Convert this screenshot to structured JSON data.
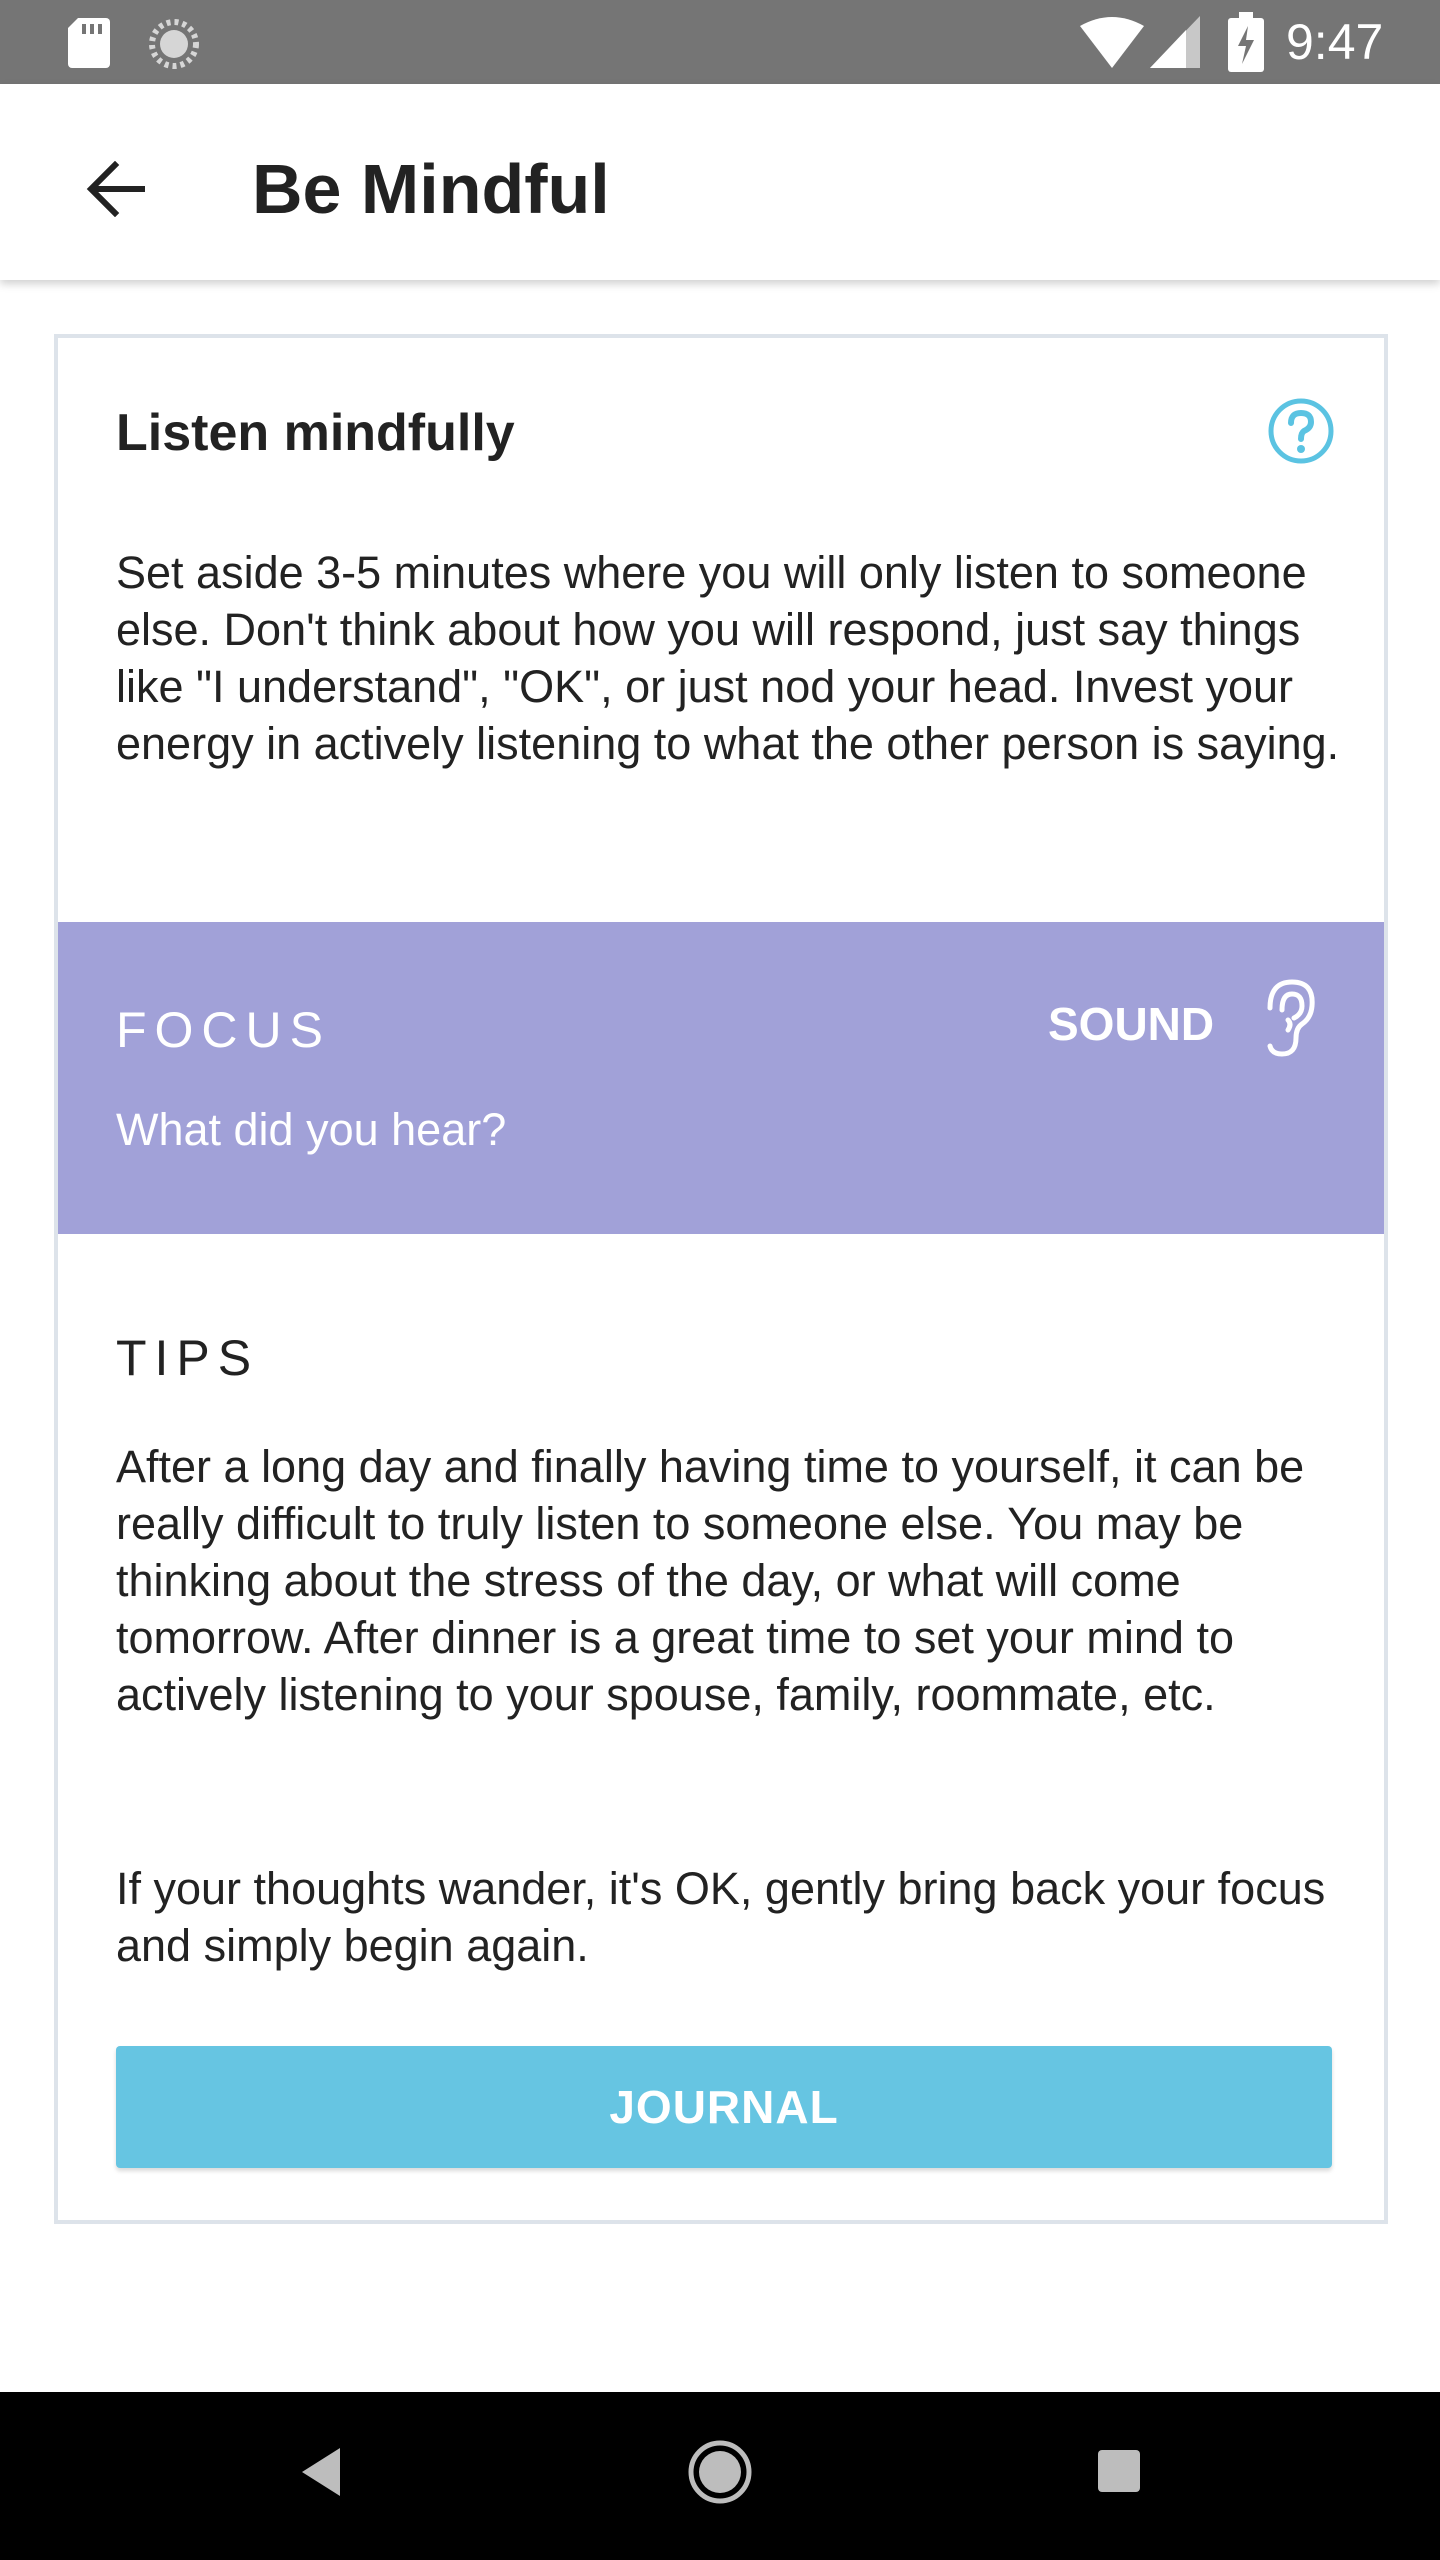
{
  "status_bar": {
    "time": "9:47",
    "icons": [
      "sd-card-icon",
      "sync-icon",
      "wifi-icon",
      "signal-icon",
      "battery-charging-icon"
    ]
  },
  "app_bar": {
    "title": "Be Mindful",
    "back_icon": "arrow-back-icon"
  },
  "card": {
    "title": "Listen mindfully",
    "help_icon": "question-circle-icon",
    "description": "Set aside 3-5 minutes where you will only listen to someone else. Don't think about how you will respond, just say things like \"I understand\", \"OK\", or just nod your head. Invest your energy in actively listening to what the other person is saying.",
    "focus": {
      "label": "FOCUS",
      "prompt": "What did you hear?",
      "sense_label": "SOUND",
      "sense_icon": "ear-icon"
    },
    "tips": {
      "label": "TIPS",
      "paragraph1": "After a long day and finally having time to yourself, it can be really difficult to truly listen to someone else. You may be thinking about the stress of the day, or what will come tomorrow. After dinner is a great time to set your mind to actively listening to your spouse, family, roommate, etc.",
      "paragraph2": "If your thoughts wander, it's OK, gently bring back your focus and simply begin again."
    },
    "journal_button": "JOURNAL"
  },
  "colors": {
    "status_bar": "#757575",
    "focus_band": "#a1a1d8",
    "accent": "#66c5e2",
    "help_icon": "#5bc3e2",
    "text": "#222222",
    "nav_bar": "#000000"
  },
  "nav_bar": {
    "buttons": [
      "nav-back-icon",
      "nav-home-icon",
      "nav-recent-icon"
    ]
  }
}
